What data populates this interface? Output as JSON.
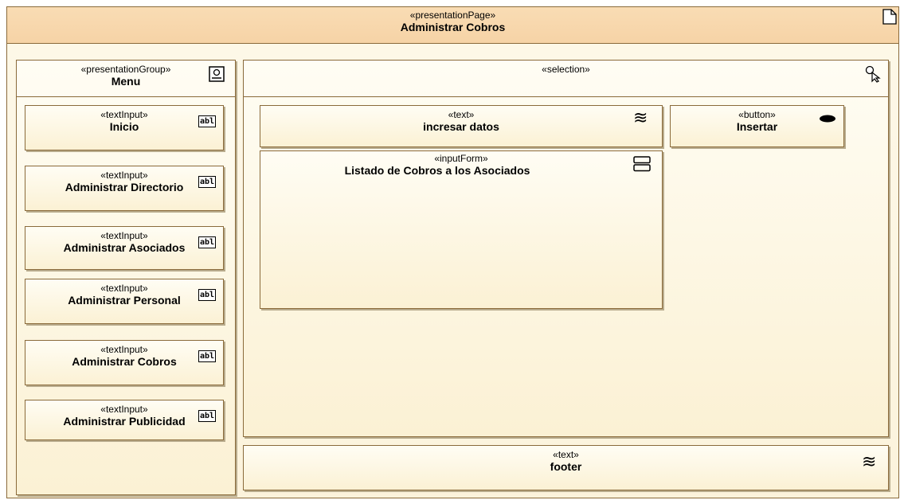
{
  "page": {
    "stereotype": "«presentationPage»",
    "title": "Administrar Cobros",
    "icon": "page-icon"
  },
  "menu": {
    "stereotype": "«presentationGroup»",
    "title": "Menu",
    "icon": "presentation-group-icon",
    "items": [
      {
        "stereotype": "«textInput»",
        "label": "Inicio",
        "icon": "abl-text-input-icon",
        "icon_text": "abl"
      },
      {
        "stereotype": "«textInput»",
        "label": "Administrar Directorio",
        "icon": "abl-text-input-icon",
        "icon_text": "abl"
      },
      {
        "stereotype": "«textInput»",
        "label": "Administrar Asociados",
        "icon": "abl-text-input-icon",
        "icon_text": "abl"
      },
      {
        "stereotype": "«textInput»",
        "label": "Administrar Personal",
        "icon": "abl-text-input-icon",
        "icon_text": "abl"
      },
      {
        "stereotype": "«textInput»",
        "label": "Administrar Cobros",
        "icon": "abl-text-input-icon",
        "icon_text": "abl"
      },
      {
        "stereotype": "«textInput»",
        "label": "Administrar Publicidad",
        "icon": "abl-text-input-icon",
        "icon_text": "abl"
      }
    ]
  },
  "selection": {
    "stereotype": "«selection»",
    "icon": "selection-cursor-icon",
    "text_box": {
      "stereotype": "«text»",
      "label": "incresar datos",
      "icon": "text-wave-icon",
      "icon_glyph": "≋"
    },
    "button_box": {
      "stereotype": "«button»",
      "label": "Insertar",
      "icon": "button-oval-icon"
    },
    "form_box": {
      "stereotype": "«inputForm»",
      "label": "Listado de Cobros a los Asociados",
      "icon": "input-form-icon"
    }
  },
  "footer": {
    "stereotype": "«text»",
    "label": "footer",
    "icon": "text-wave-icon",
    "icon_glyph": "≋"
  },
  "colors": {
    "header_fill": "#f7d8ad",
    "element_fill": "#fdf6df",
    "border": "#8a6a3a"
  }
}
